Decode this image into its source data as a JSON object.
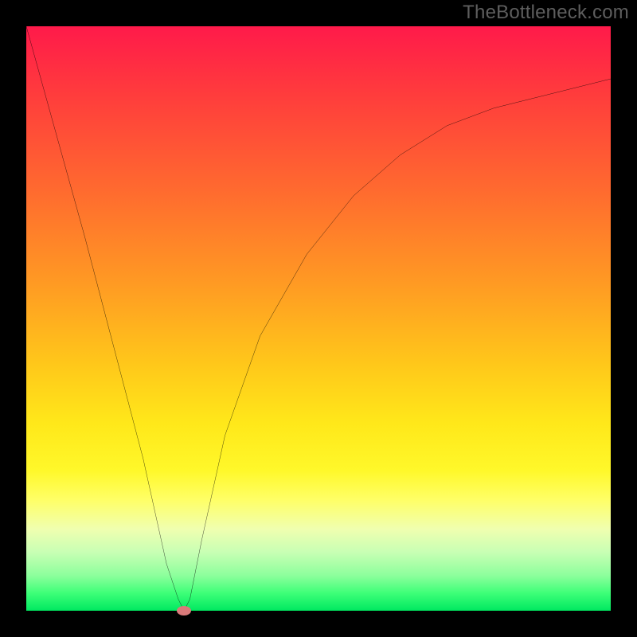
{
  "watermark": "TheBottleneck.com",
  "colors": {
    "frame": "#000000",
    "curve": "#000000",
    "marker": "#da7a7a",
    "gradient_stops": [
      "#ff1a4a",
      "#ff3d3c",
      "#ff6a2f",
      "#ff9a23",
      "#ffc81a",
      "#ffe81a",
      "#fff82a",
      "#ffff66",
      "#f0ffb0",
      "#c8ffb4",
      "#8cff9c",
      "#3dff78",
      "#00e860"
    ]
  },
  "chart_data": {
    "type": "line",
    "title": "",
    "xlabel": "",
    "ylabel": "",
    "xlim": [
      0,
      100
    ],
    "ylim": [
      0,
      100
    ],
    "series": [
      {
        "name": "bottleneck-curve",
        "x": [
          0,
          5,
          10,
          15,
          20,
          24,
          26,
          27,
          28,
          30,
          34,
          40,
          48,
          56,
          64,
          72,
          80,
          88,
          96,
          100
        ],
        "y": [
          100,
          82,
          64,
          45,
          26,
          8,
          2,
          0,
          2,
          12,
          30,
          47,
          61,
          71,
          78,
          83,
          86,
          88,
          90,
          91
        ]
      }
    ],
    "annotations": [
      {
        "name": "min-marker",
        "x": 27,
        "y": 0
      }
    ]
  }
}
